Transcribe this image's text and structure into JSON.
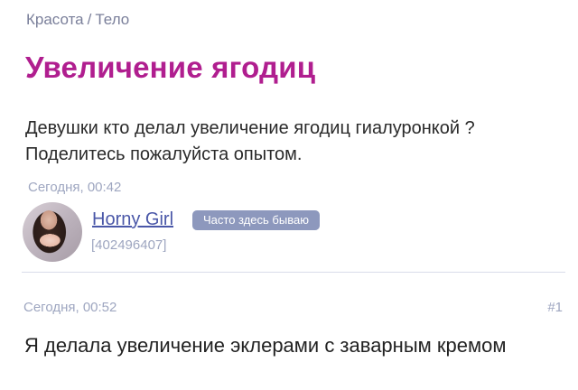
{
  "breadcrumb": {
    "category": "Красота",
    "separator": "/",
    "subcategory": "Тело"
  },
  "topic": {
    "title": "Увеличение ягодиц",
    "question": "Девушки кто делал увеличение ягодиц гиалуронкой ? Поделитесь пожалуйста опытом.",
    "timestamp": "Сегодня, 00:42"
  },
  "author": {
    "name": "Horny Girl",
    "badge": "Часто здесь бываю",
    "user_id": "[402496407]"
  },
  "reply": {
    "timestamp": "Сегодня, 00:52",
    "number": "#1",
    "text": "Я делала увеличение эклерами с заварным кремом"
  }
}
